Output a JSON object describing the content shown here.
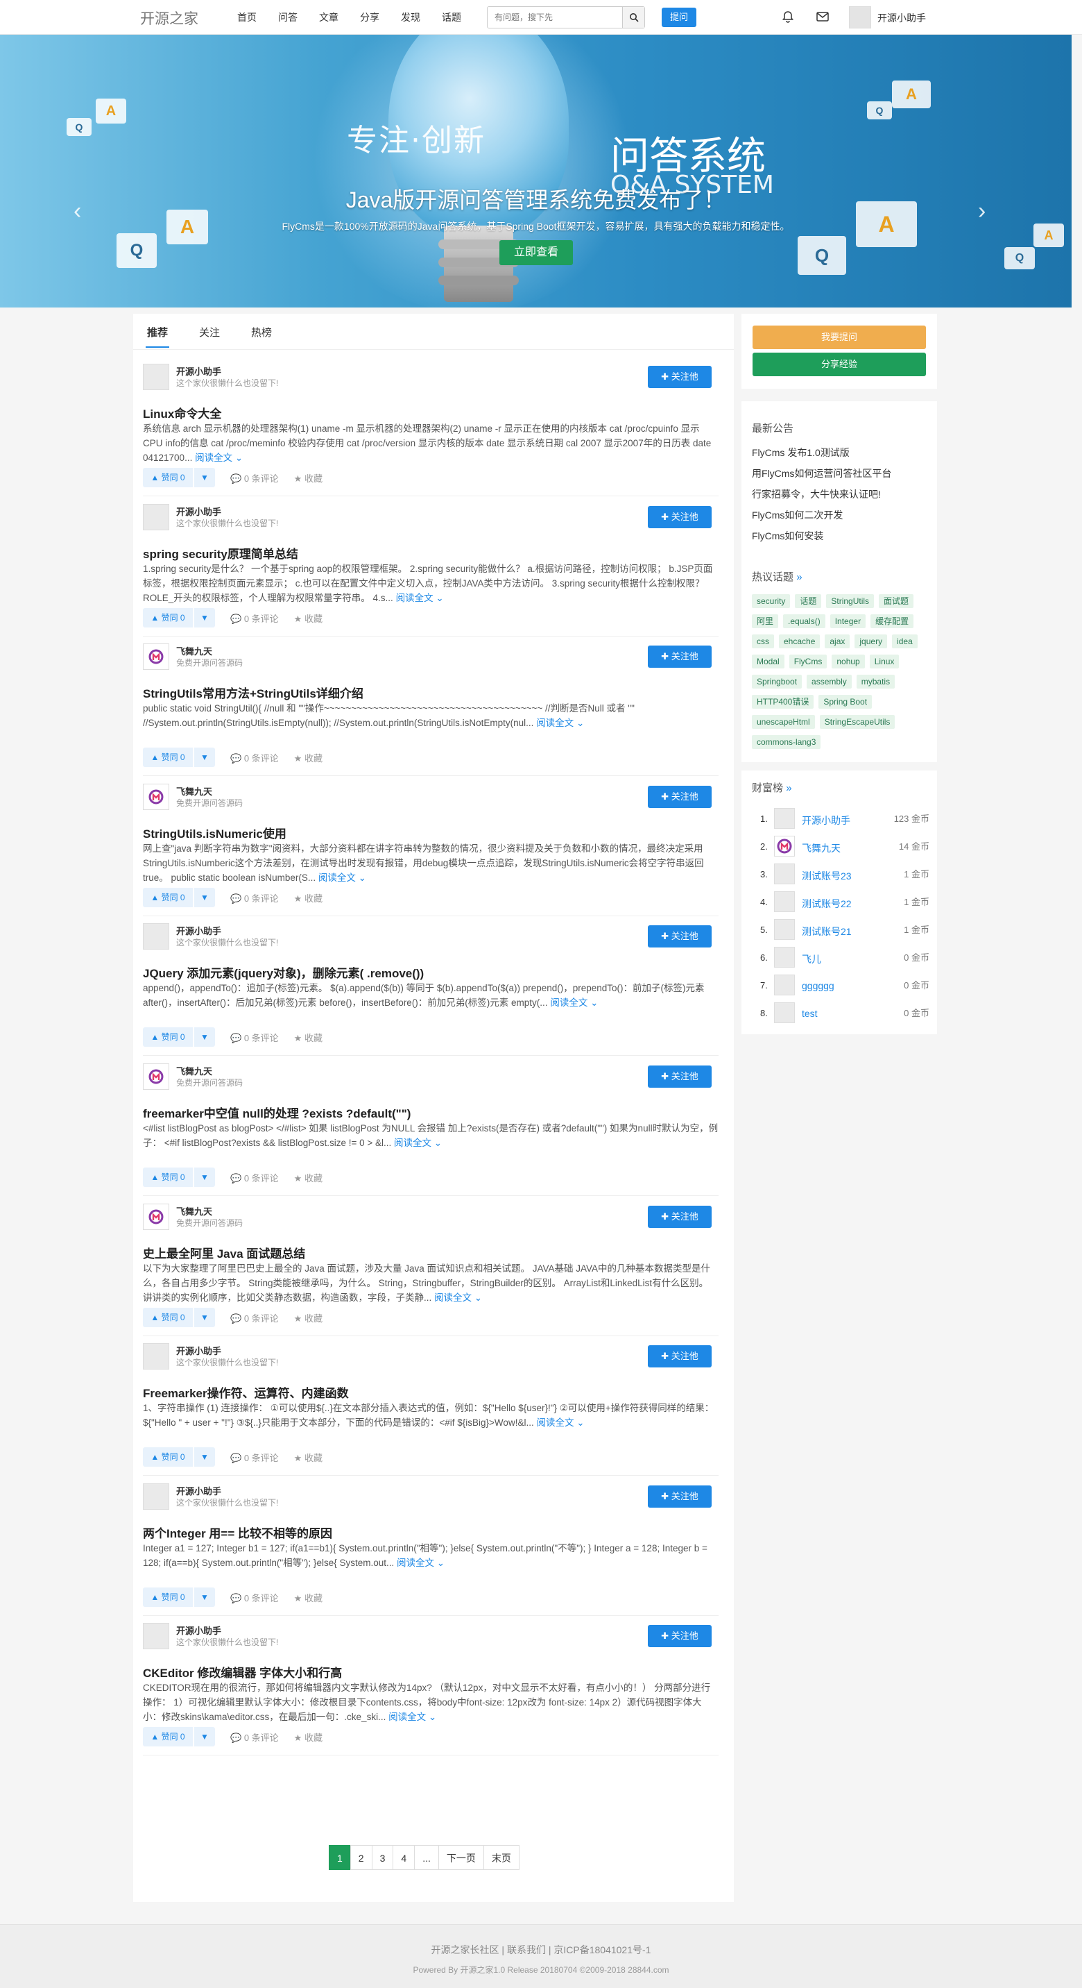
{
  "header": {
    "logo": "开源之家",
    "nav": [
      "首页",
      "问答",
      "文章",
      "分享",
      "发现",
      "话题"
    ],
    "search_placeholder": "有问题，搜下先",
    "ask_label": "提问",
    "username": "开源小助手"
  },
  "banner": {
    "slogan": "专注·创新",
    "system_cn": "问答系统",
    "system_en": "Q&A SYSTEM",
    "title": "Java版开源问答管理系统免费发布了！",
    "desc": "FlyCms是一款100%开放源码的Java问答系统，基于Spring Boot框架开发，容易扩展，具有强大的负载能力和稳定性。",
    "button": "立即查看",
    "prev": "‹",
    "next": "›"
  },
  "tabs": [
    "推荐",
    "关注",
    "热榜"
  ],
  "posts": [
    {
      "user": "开源小助手",
      "sig": "这个家伙很懒什么也没留下!",
      "avatar": "default",
      "title": "Linux命令大全",
      "body": "系统信息 arch 显示机器的处理器架构(1) uname -m 显示机器的处理器架构(2) uname -r 显示正在使用的内核版本 cat /proc/cpuinfo 显示CPU info的信息 cat /proc/meminfo 校验内存使用 cat /proc/version 显示内核的版本 date 显示系统日期 cal 2007 显示2007年的日历表 date 04121700..."
    },
    {
      "user": "开源小助手",
      "sig": "这个家伙很懒什么也没留下!",
      "avatar": "default",
      "title": "spring security原理简单总结",
      "body": "1.spring security是什么？ 一个基于spring aop的权限管理框架。 2.spring security能做什么？ a.根据访问路径，控制访问权限； b.JSP页面标签，根据权限控制页面元素显示； c.也可以在配置文件中定义切入点，控制JAVA类中方法访问。 3.spring security根据什么控制权限？ ROLE_开头的权限标签，个人理解为权限常量字符串。 4.s..."
    },
    {
      "user": "飞舞九天",
      "sig": "免费开源问答源码",
      "avatar": "fw",
      "title": "StringUtils常用方法+StringUtils详细介绍",
      "body": "public static void StringUtil(){ //null 和 \"\"操作~~~~~~~~~~~~~~~~~~~~~~~~~~~~~~~~~~~~~~~~ //判断是否Null 或者 \"\" //System.out.println(StringUtils.isEmpty(null)); //System.out.println(StringUtils.isNotEmpty(nul..."
    },
    {
      "user": "飞舞九天",
      "sig": "免费开源问答源码",
      "avatar": "fw",
      "title": "StringUtils.isNumeric使用",
      "body": "网上查\"java 判断字符串为数字\"阅资料，大部分资料都在讲字符串转为整数的情况，很少资料提及关于负数和小数的情况，最终决定采用StringUtils.isNumberic这个方法差别，在测试导出时发现有报错，用debug模块一点点追踪，发现StringUtils.isNumeric会将空字符串返回true。 public static boolean isNumber(S..."
    },
    {
      "user": "开源小助手",
      "sig": "这个家伙很懒什么也没留下!",
      "avatar": "default",
      "title": "JQuery 添加元素(jquery对象)，删除元素( .remove())",
      "body": "append()，appendTo()：追加子(标签)元素。 $(a).append($(b)) 等同于 $(b).appendTo($(a)) prepend()，prependTo()：前加子(标签)元素 after()，insertAfter()：后加兄弟(标签)元素 before()，insertBefore()：前加兄弟(标签)元素 empty(..."
    },
    {
      "user": "飞舞九天",
      "sig": "免费开源问答源码",
      "avatar": "fw",
      "title": "freemarker中空值 null的处理 ?exists ?default(\"\")",
      "body": "<#list listBlogPost as blogPost> </#list> 如果 listBlogPost 为NULL 会报错 加上?exists(是否存在) 或者?default(\"\") 如果为null时默认为空，例子： <#if listBlogPost?exists && listBlogPost.size != 0 > &l..."
    },
    {
      "user": "飞舞九天",
      "sig": "免费开源问答源码",
      "avatar": "fw",
      "title": "史上最全阿里 Java 面试题总结",
      "body": "以下为大家整理了阿里巴巴史上最全的 Java 面试题，涉及大量 Java 面试知识点和相关试题。 JAVA基础 JAVA中的几种基本数据类型是什么，各自占用多少字节。 String类能被继承吗，为什么。 String，Stringbuffer，StringBuilder的区别。 ArrayList和LinkedList有什么区别。 讲讲类的实例化顺序，比如父类静态数据，构造函数，字段，子类静..."
    },
    {
      "user": "开源小助手",
      "sig": "这个家伙很懒什么也没留下!",
      "avatar": "default",
      "title": "Freemarker操作符、运算符、内建函数",
      "body": "1、字符串操作 (1) 连接操作： ①可以使用${..}在文本部分插入表达式的值，例如：${\"Hello ${user}!\"} ②可以使用+操作符获得同样的结果：${\"Hello \" + user + \"!\"} ③${..}只能用于文本部分，下面的代码是错误的：<#if ${isBig}>Wow!&l..."
    },
    {
      "user": "开源小助手",
      "sig": "这个家伙很懒什么也没留下!",
      "avatar": "default",
      "title": "两个Integer 用== 比较不相等的原因",
      "body": "Integer a1 = 127; Integer b1 = 127; if(a1==b1){ System.out.println(\"相等\"); }else{ System.out.println(\"不等\"); } Integer a = 128; Integer b = 128; if(a==b){ System.out.println(\"相等\"); }else{ System.out..."
    },
    {
      "user": "开源小助手",
      "sig": "这个家伙很懒什么也没留下!",
      "avatar": "default",
      "title": "CKEditor 修改编辑器 字体大小和行高",
      "body": "CKEDITOR现在用的很流行，那如何将编辑器内文字默认修改为14px? （默认12px，对中文显示不太好看，有点小小的！） 分两部分进行操作： 1）可视化编辑里默认字体大小：修改根目录下contents.css，将body中font-size: 12px改为 font-size: 14px 2）源代码视图字体大小：修改skins\\kama\\editor.css，在最后加一句：.cke_ski..."
    }
  ],
  "post_labels": {
    "follow": "✚ 关注他",
    "vote": "▲ 赞同 0",
    "vote_down": "▼",
    "comments": "0 条评论",
    "collect": "收藏",
    "read_more": "阅读全文 ⌄"
  },
  "pager": [
    "1",
    "2",
    "3",
    "4",
    "...",
    "下一页",
    "末页"
  ],
  "sidebar": {
    "ask_button": "我要提问",
    "share_button": "分享经验",
    "notice_title": "最新公告",
    "notices": [
      "FlyCms 发布1.0测试版",
      "用FlyCms如何运营问答社区平台",
      "行家招募令，大牛快来认证吧!",
      "FlyCms如何二次开发",
      "FlyCms如何安装"
    ],
    "topics_title": "热议话题",
    "tags": [
      "security",
      "话题",
      "StringUtils",
      "面试题",
      "阿里",
      ".equals()",
      "Integer",
      "缓存配置",
      "css",
      "ehcache",
      "ajax",
      "jquery",
      "idea",
      "Modal",
      "FlyCms",
      "nohup",
      "Linux",
      "Springboot",
      "assembly",
      "mybatis",
      "HTTP400错误",
      "Spring Boot",
      "unescapeHtml",
      "StringEscapeUtils",
      "commons-lang3"
    ],
    "rank_title": "财富榜",
    "more": "»",
    "rank": [
      {
        "n": "1.",
        "name": "开源小助手",
        "coins": "123 金币",
        "avatar": "default"
      },
      {
        "n": "2.",
        "name": "飞舞九天",
        "coins": "14 金币",
        "avatar": "fw"
      },
      {
        "n": "3.",
        "name": "测试账号23",
        "coins": "1 金币",
        "avatar": "default"
      },
      {
        "n": "4.",
        "name": "测试账号22",
        "coins": "1 金币",
        "avatar": "default"
      },
      {
        "n": "5.",
        "name": "测试账号21",
        "coins": "1 金币",
        "avatar": "default"
      },
      {
        "n": "6.",
        "name": "飞儿",
        "coins": "0 金币",
        "avatar": "default"
      },
      {
        "n": "7.",
        "name": "gggggg",
        "coins": "0 金币",
        "avatar": "default"
      },
      {
        "n": "8.",
        "name": "test",
        "coins": "0 金币",
        "avatar": "default"
      }
    ]
  },
  "footer": {
    "links": "开源之家长社区 | 联系我们 | 京ICP备18041021号-1",
    "powered": "Powered By 开源之家1.0 Release 20180704 ©2009-2018 28844.com"
  },
  "colors": {
    "primary": "#1e88e5",
    "green": "#1e9e5a",
    "orange": "#f0ad4e"
  }
}
